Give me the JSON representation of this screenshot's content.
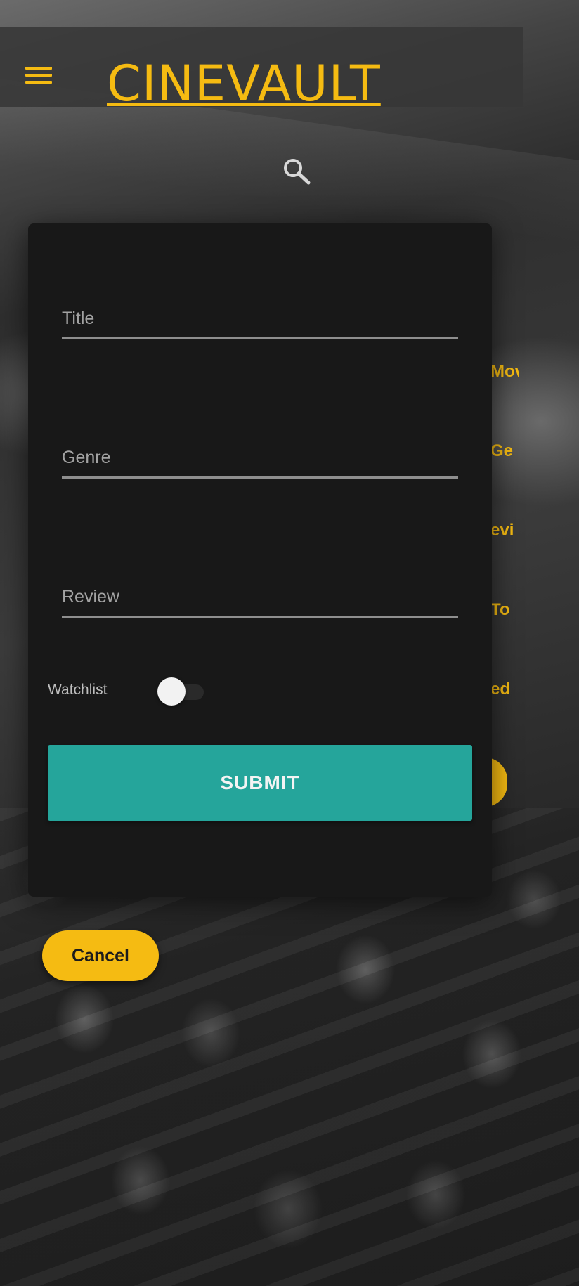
{
  "app": {
    "brand": "CINEVAULT",
    "accent_color": "#f5bb12"
  },
  "header": {
    "menu_icon": "hamburger-menu-icon",
    "search_icon": "search-icon"
  },
  "side_nav_peek": [
    "Mov",
    "Ge",
    "evi",
    "To",
    "ed"
  ],
  "form": {
    "title_placeholder": "Title",
    "genre_placeholder": "Genre",
    "review_placeholder": "Review",
    "watchlist_label": "Watchlist",
    "watchlist_on": false,
    "submit_label": "SUBMIT",
    "submit_color": "#25a59b"
  },
  "cancel_label": "Cancel"
}
